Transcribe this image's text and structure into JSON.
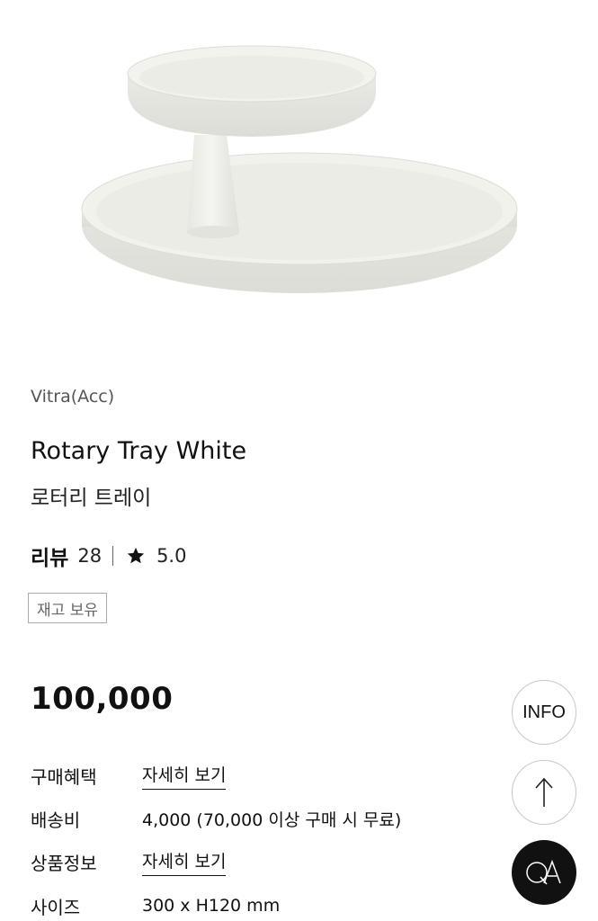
{
  "product": {
    "brand": "Vitra(Acc)",
    "title_en": "Rotary Tray White",
    "title_ko": "로터리 트레이",
    "review_label": "리뷰",
    "review_count": "28",
    "rating": "5.0",
    "stock_badge": "재고 보유",
    "price": "100,000"
  },
  "info": [
    {
      "label": "구매혜택",
      "value": "자세히 보기",
      "is_link": true
    },
    {
      "label": "배송비",
      "value": "4,000 (70,000 이상 구매 시 무료)",
      "is_link": false
    },
    {
      "label": "상품정보",
      "value": "자세히 보기",
      "is_link": true
    },
    {
      "label": "사이즈",
      "value": "300 x H120 mm",
      "is_link": false
    }
  ],
  "floating": {
    "info_label": "INFO",
    "top_icon": "arrow-up-icon",
    "qa_icon": "qa-icon"
  },
  "colors": {
    "text": "#111111",
    "muted": "#555555",
    "tray": "#eeefe9",
    "qa_bg": "#111111"
  }
}
